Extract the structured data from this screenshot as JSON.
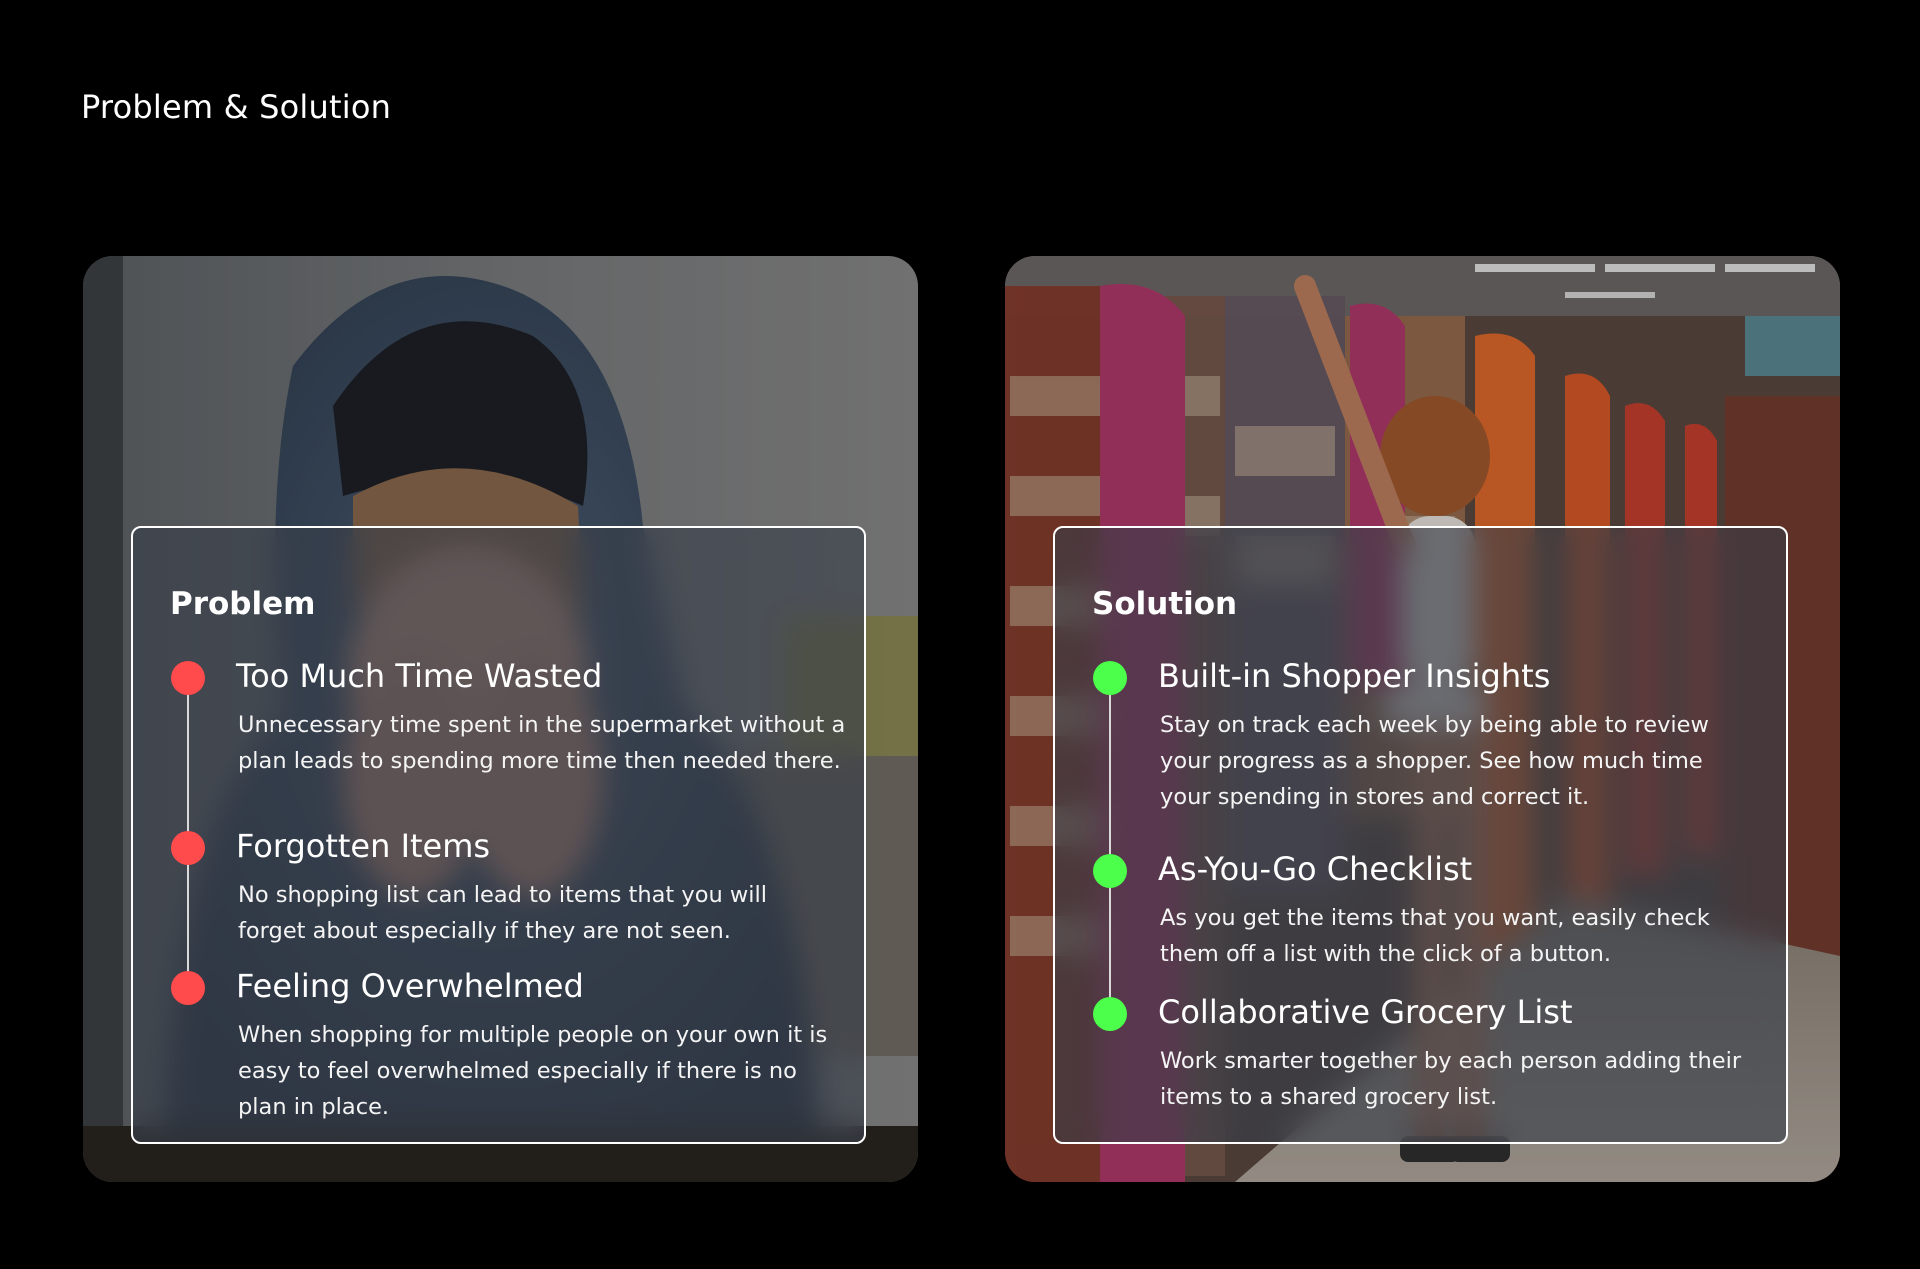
{
  "page": {
    "title": "Problem & Solution"
  },
  "problem": {
    "heading": "Problem",
    "accent": "#ff4b4b",
    "items": [
      {
        "title": "Too Much Time Wasted",
        "description": "Unnecessary time spent in the supermarket without a plan leads to spending more time then needed there."
      },
      {
        "title": "Forgotten Items",
        "description": "No shopping list can lead to items that you will forget about especially if they are not seen."
      },
      {
        "title": "Feeling Overwhelmed",
        "description": "When shopping for multiple people on your own it is easy to feel overwhelmed especially if there is no plan in place."
      }
    ]
  },
  "solution": {
    "heading": "Solution",
    "accent": "#4bff4b",
    "items": [
      {
        "title": "Built-in Shopper Insights",
        "description": "Stay on track each week by being able to review your progress as a shopper. See how much time your spending in stores and correct it."
      },
      {
        "title": "As-You-Go Checklist",
        "description": "As you get the items that you want, easily check them off a list with the click of a button."
      },
      {
        "title": "Collaborative Grocery List",
        "description": "Work smarter together by each person adding their items to a shared grocery list."
      }
    ]
  },
  "images": {
    "problem_photo": "stressed-person-in-hoodie-photo",
    "solution_photo": "supermarket-aisle-shopper-photo"
  }
}
